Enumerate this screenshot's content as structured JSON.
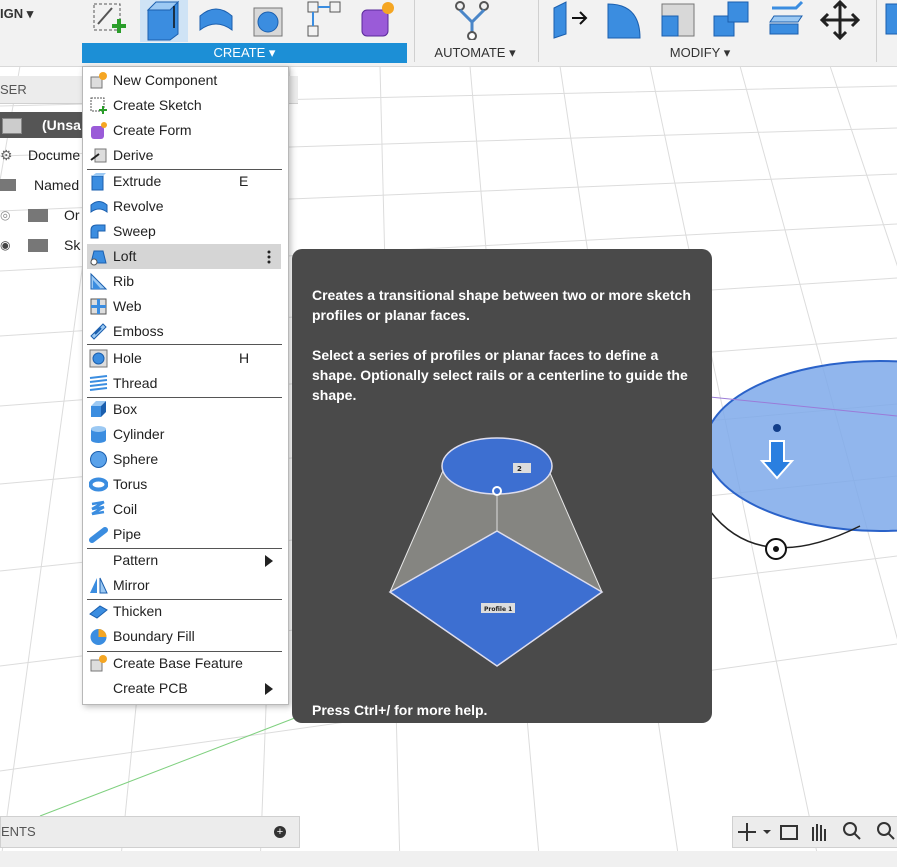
{
  "toolbar": {
    "workspace_label": "IGN",
    "groups": {
      "create": "CREATE",
      "automate": "AUTOMATE",
      "modify": "MODIFY"
    },
    "dropdown_glyph": "▾",
    "accent": "#1c8fd6"
  },
  "browser": {
    "header": "SER",
    "rows": {
      "root": "(Unsa",
      "document": "Docume",
      "named": "Named",
      "origin": "Or",
      "sketches": "Sk"
    },
    "bottom_label": "ENTS"
  },
  "create_menu": {
    "items": {
      "new_component": "New Component",
      "create_sketch": "Create Sketch",
      "create_form": "Create Form",
      "derive": "Derive",
      "extrude": "Extrude",
      "extrude_shortcut": "E",
      "revolve": "Revolve",
      "sweep": "Sweep",
      "loft": "Loft",
      "rib": "Rib",
      "web": "Web",
      "emboss": "Emboss",
      "hole": "Hole",
      "hole_shortcut": "H",
      "thread": "Thread",
      "box": "Box",
      "cylinder": "Cylinder",
      "sphere": "Sphere",
      "torus": "Torus",
      "coil": "Coil",
      "pipe": "Pipe",
      "pattern": "Pattern",
      "mirror": "Mirror",
      "thicken": "Thicken",
      "boundary_fill": "Boundary Fill",
      "create_base_feature": "Create Base Feature",
      "create_pcb": "Create PCB"
    },
    "highlighted": "loft"
  },
  "tooltip": {
    "line1": "Creates a transitional shape between two or more sketch profiles or planar faces.",
    "line2": "Select a series of profiles or planar faces to define a shape. Optionally select rails or a centerline to guide the shape.",
    "footer": "Press Ctrl+/ for more help.",
    "illustration_profile_label": "Profile 1",
    "illustration_top_label": "2"
  },
  "icons": {
    "loft_options": "more-vertical-icon",
    "nav": [
      "orbit-icon",
      "look-at-icon",
      "pan-icon",
      "zoom-icon",
      "fit-icon"
    ]
  }
}
